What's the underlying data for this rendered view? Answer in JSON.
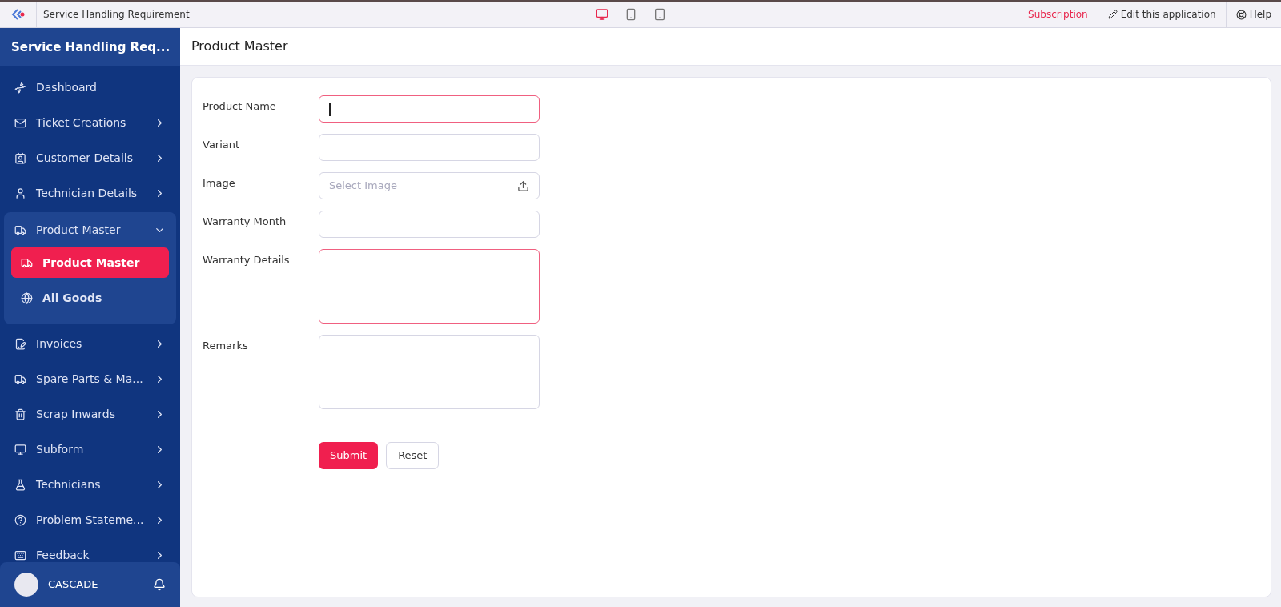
{
  "topbar": {
    "app_title": "Service Handling Requirement",
    "devices": [
      {
        "kind": "desktop",
        "selected": true
      },
      {
        "kind": "phone",
        "selected": false
      },
      {
        "kind": "tablet",
        "selected": false
      }
    ],
    "subscription": "Subscription",
    "edit": "Edit this application",
    "help": "Help"
  },
  "sidebar": {
    "title": "Service Handling Req...",
    "items": [
      {
        "label": "Dashboard"
      },
      {
        "label": "Ticket Creations",
        "expanded": false
      },
      {
        "label": "Customer Details",
        "expanded": false
      },
      {
        "label": "Technician Details",
        "expanded": false
      },
      {
        "label": "Product Master",
        "expanded": true,
        "children": [
          {
            "label": "Product Master",
            "selected": true
          },
          {
            "label": "All Goods",
            "selected": false
          }
        ]
      },
      {
        "label": "Invoices",
        "expanded": false
      },
      {
        "label": "Spare Parts & Ma...",
        "expanded": false
      },
      {
        "label": "Scrap Inwards",
        "expanded": false
      },
      {
        "label": "Subform",
        "expanded": false
      },
      {
        "label": "Technicians",
        "expanded": false
      },
      {
        "label": "Problem Stateme...",
        "expanded": false
      },
      {
        "label": "Feedback",
        "expanded": false
      }
    ],
    "user": "CASCADE"
  },
  "page": {
    "title": "Product Master"
  },
  "form": {
    "fields": [
      {
        "label": "Product Name",
        "kind": "text",
        "highlighted": true,
        "focused": true
      },
      {
        "label": "Variant",
        "kind": "text",
        "highlighted": false
      },
      {
        "label": "Image",
        "kind": "file",
        "placeholder": "Select Image",
        "highlighted": false
      },
      {
        "label": "Warranty Month",
        "kind": "text",
        "highlighted": false
      },
      {
        "label": "Warranty Details",
        "kind": "textarea",
        "highlighted": true
      },
      {
        "label": "Remarks",
        "kind": "textarea",
        "highlighted": false
      }
    ],
    "buttons": [
      {
        "label": "Submit",
        "kind": "primary"
      },
      {
        "label": "Reset",
        "kind": "secondary"
      }
    ]
  }
}
